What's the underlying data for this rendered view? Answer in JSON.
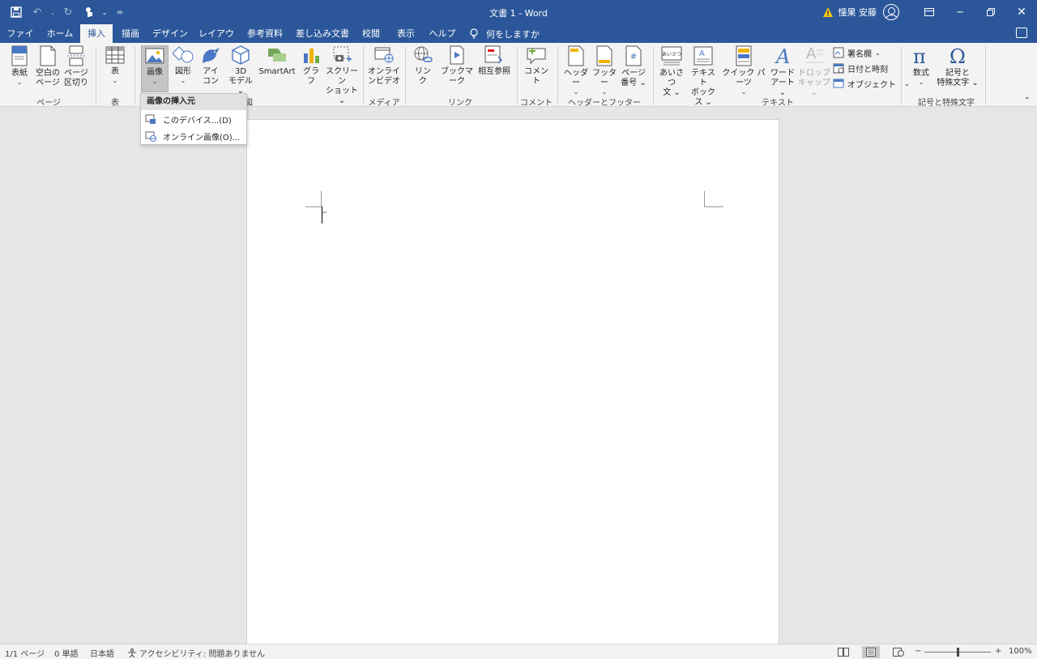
{
  "title_bar": {
    "document_title": "文書 1 - Word",
    "user_name": "憧果 安藤",
    "qat_customize": "="
  },
  "tabs": [
    "ファイル",
    "ホーム",
    "挿入",
    "描画",
    "デザイン",
    "レイアウト",
    "参考資料",
    "差し込み文書",
    "校閲",
    "表示",
    "ヘルプ"
  ],
  "active_tab": "挿入",
  "tell_me": "何をしますか",
  "ribbon": {
    "groups": {
      "pages": "ページ",
      "tables": "表",
      "illustrations": "図",
      "media": "メディア",
      "links": "リンク",
      "comments": "コメント",
      "header_footer": "ヘッダーとフッター",
      "text": "テキスト",
      "symbols": "記号と特殊文字"
    },
    "buttons": {
      "cover_page": [
        "表紙",
        "⌄"
      ],
      "blank_page": [
        "空白の",
        "ページ"
      ],
      "page_break": [
        "ページ",
        "区切り"
      ],
      "table": [
        "表",
        "⌄"
      ],
      "pictures": [
        "画像",
        "⌄"
      ],
      "shapes": [
        "図形",
        "⌄"
      ],
      "icons": [
        "アイ",
        "コン"
      ],
      "model_3d": [
        "3D",
        "モデル ⌄"
      ],
      "smartart": "SmartArt",
      "chart": "グラフ",
      "screenshot": [
        "スクリーン",
        "ショット ⌄"
      ],
      "online_video": [
        "オンライ",
        "ンビデオ"
      ],
      "link": [
        "リン",
        "ク"
      ],
      "bookmark": "ブックマーク",
      "cross_reference": "相互参照",
      "comment": "コメント",
      "header": [
        "ヘッダー",
        "⌄"
      ],
      "footer": [
        "フッター",
        "⌄"
      ],
      "page_number": [
        "ページ",
        "番号 ⌄"
      ],
      "greeting": [
        "あいさつ",
        "文 ⌄"
      ],
      "text_box": [
        "テキスト",
        "ボックス ⌄"
      ],
      "quick_parts": [
        "クイック パーツ",
        "⌄"
      ],
      "wordart": [
        "ワード",
        "アート ⌄"
      ],
      "drop_cap": [
        "ドロップ",
        "キャップ ⌄"
      ],
      "signature_line": "署名欄",
      "date_time": "日付と時刻",
      "object": "オブジェクト",
      "equation": [
        "数式",
        "⌄"
      ],
      "symbol": [
        "記号と",
        "特殊文字 ⌄"
      ]
    },
    "icon_labels": {
      "greeting": "あいさつ",
      "page_number": "#"
    }
  },
  "picture_menu": {
    "header": "画像の挿入元",
    "items": [
      "このデバイス...(D)",
      "オンライン画像(O)..."
    ]
  },
  "status_bar": {
    "page": "1/1 ページ",
    "words": "0 単語",
    "language": "日本語",
    "accessibility": "アクセシビリティ: 問題ありません",
    "zoom": "100%",
    "zoom_level": 1.0
  },
  "colors": {
    "accent": "#2b579a",
    "ribbon_bg": "#f3f3f3",
    "canvas_bg": "#e6e6e6"
  }
}
